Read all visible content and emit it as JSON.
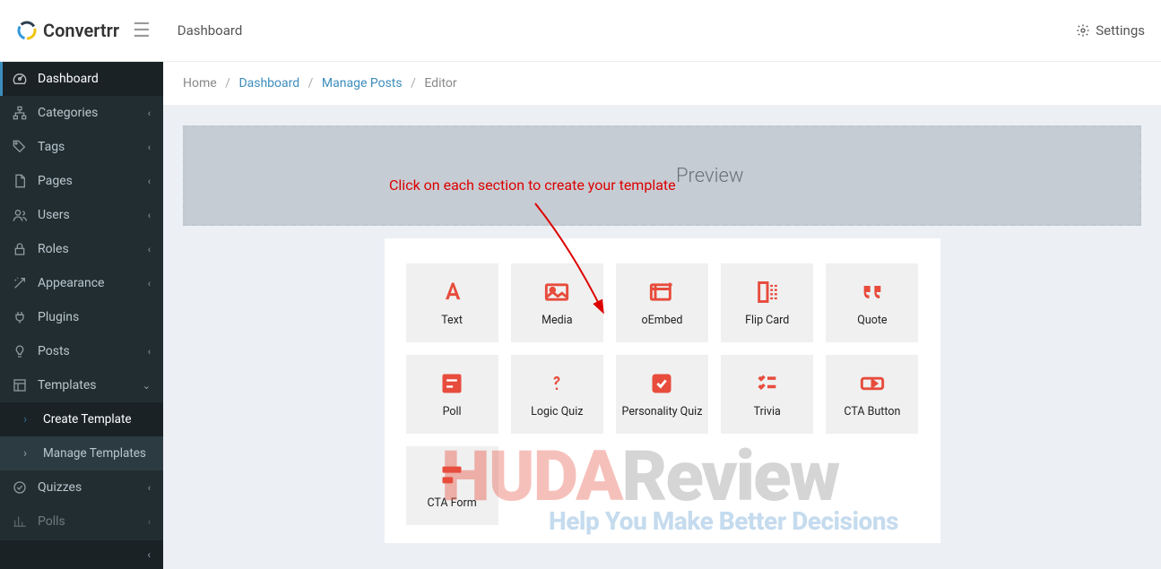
{
  "brand": {
    "name": "Convertrr"
  },
  "topbar": {
    "title": "Dashboard",
    "settings_label": "Settings"
  },
  "breadcrumb": {
    "home": "Home",
    "dashboard": "Dashboard",
    "manage_posts": "Manage Posts",
    "editor": "Editor"
  },
  "preview": {
    "label": "Preview"
  },
  "annotation": {
    "text": "Click on each section to create your template"
  },
  "sidebar": {
    "items": [
      {
        "key": "dashboard",
        "label": "Dashboard",
        "icon": "tachometer-icon",
        "active": true
      },
      {
        "key": "categories",
        "label": "Categories",
        "icon": "sitemap-icon",
        "expandable": true
      },
      {
        "key": "tags",
        "label": "Tags",
        "icon": "tag-icon",
        "expandable": true
      },
      {
        "key": "pages",
        "label": "Pages",
        "icon": "page-icon",
        "expandable": true
      },
      {
        "key": "users",
        "label": "Users",
        "icon": "users-icon",
        "expandable": true
      },
      {
        "key": "roles",
        "label": "Roles",
        "icon": "lock-icon",
        "expandable": true
      },
      {
        "key": "appearance",
        "label": "Appearance",
        "icon": "wand-icon",
        "expandable": true
      },
      {
        "key": "plugins",
        "label": "Plugins",
        "icon": "plug-icon"
      },
      {
        "key": "posts",
        "label": "Posts",
        "icon": "bulb-icon",
        "expandable": true
      },
      {
        "key": "templates",
        "label": "Templates",
        "icon": "template-icon",
        "expandable": true,
        "expanded": true
      },
      {
        "key": "create_template",
        "label": "Create Template",
        "sub": true,
        "active_sub": true
      },
      {
        "key": "manage_templates",
        "label": "Manage Templates",
        "sub": true
      },
      {
        "key": "quizzes",
        "label": "Quizzes",
        "icon": "check-icon",
        "expandable": true
      },
      {
        "key": "polls",
        "label": "Polls",
        "icon": "chart-icon",
        "expandable": true
      }
    ]
  },
  "palette": {
    "items": [
      {
        "key": "text",
        "label": "Text",
        "icon": "text-icon"
      },
      {
        "key": "media",
        "label": "Media",
        "icon": "media-icon"
      },
      {
        "key": "oembed",
        "label": "oEmbed",
        "icon": "oembed-icon"
      },
      {
        "key": "flipcard",
        "label": "Flip Card",
        "icon": "flipcard-icon"
      },
      {
        "key": "quote",
        "label": "Quote",
        "icon": "quote-icon"
      },
      {
        "key": "poll",
        "label": "Poll",
        "icon": "poll-icon"
      },
      {
        "key": "logicquiz",
        "label": "Logic Quiz",
        "icon": "logic-icon"
      },
      {
        "key": "personalityquiz",
        "label": "Personality Quiz",
        "icon": "personality-icon"
      },
      {
        "key": "trivia",
        "label": "Trivia",
        "icon": "trivia-icon"
      },
      {
        "key": "ctabutton",
        "label": "CTA Button",
        "icon": "ctabutton-icon"
      },
      {
        "key": "ctaform",
        "label": "CTA Form",
        "icon": "ctaform-icon"
      }
    ]
  },
  "watermark": {
    "line1_a": "H",
    "line1_b": "UDA",
    "line1_c": "Review",
    "line2": "Help You Make Better Decisions"
  },
  "colors": {
    "accent": "#e74c3c",
    "link": "#3c8dbc",
    "sidebar_bg": "#222d32"
  }
}
